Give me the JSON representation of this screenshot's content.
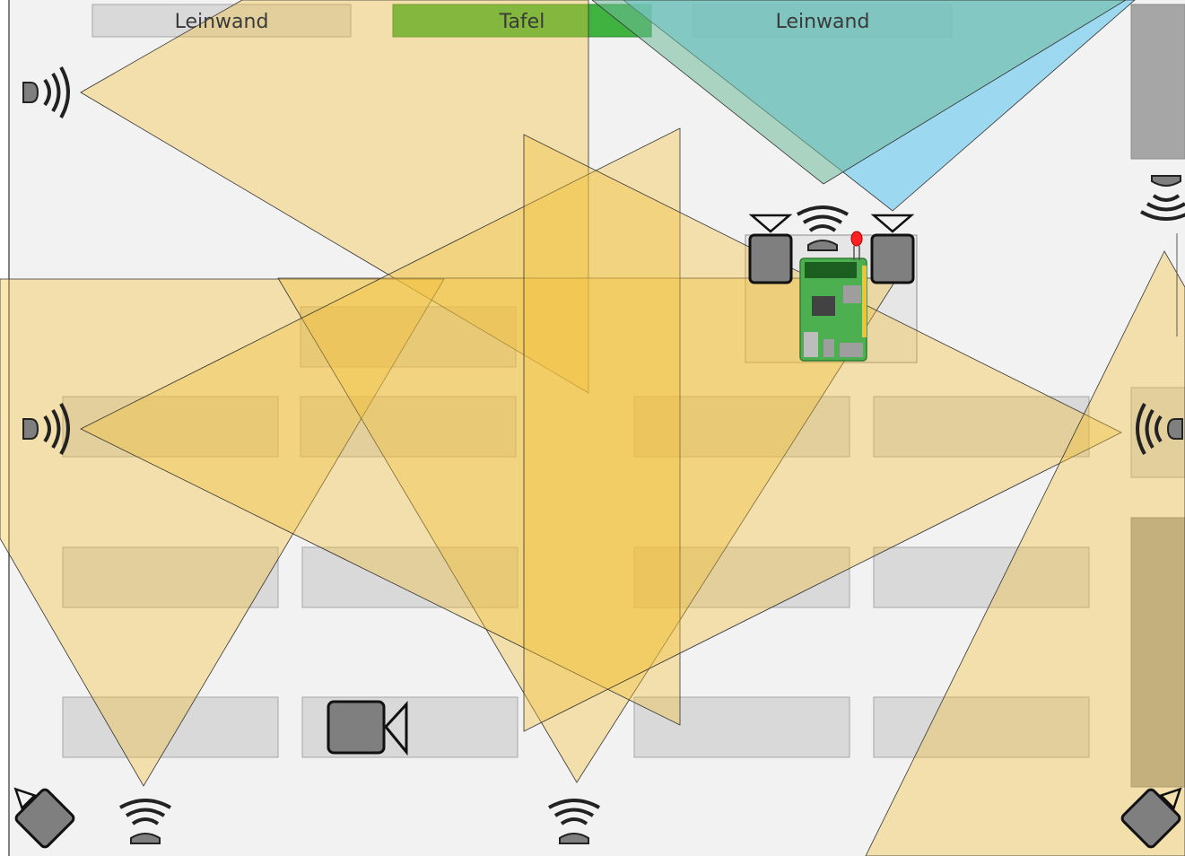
{
  "labels": {
    "screen_left": "Leinwand",
    "board": "Tafel",
    "screen_right": "Leinwand"
  },
  "colors": {
    "floor": "#f2f2f2",
    "desk": "#d9d9d9",
    "desk_border": "#a6a6a6",
    "cone": "#f2c13a",
    "board": "#3fb23f",
    "beam_green": "#6fb99a",
    "beam_blue": "#7fd0f0",
    "device_gray": "#7f7f7f",
    "cabinet": "#a6a6a6"
  },
  "icons": {
    "speaker": "speaker-icon",
    "camera": "camera-icon",
    "sensor": "sensor-icon",
    "microcontroller": "raspberry-pi-icon",
    "led": "led-icon"
  }
}
